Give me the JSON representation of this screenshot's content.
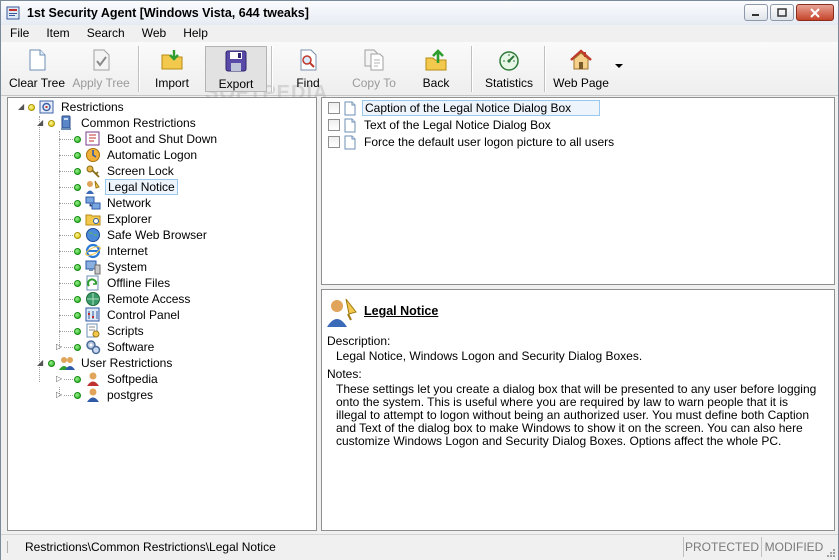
{
  "window": {
    "title": "1st Security Agent [Windows Vista, 644 tweaks]"
  },
  "menu": [
    "File",
    "Item",
    "Search",
    "Web",
    "Help"
  ],
  "toolbar": {
    "clear_tree": "Clear Tree",
    "apply_tree": "Apply Tree",
    "import": "Import",
    "export": "Export",
    "find": "Find",
    "copy_to": "Copy To",
    "back": "Back",
    "statistics": "Statistics",
    "web_page": "Web Page"
  },
  "watermark": "SOFTPEDIA",
  "tree": {
    "root": "Restrictions",
    "common": "Common Restrictions",
    "common_items": [
      "Boot and Shut Down",
      "Automatic Logon",
      "Screen Lock",
      "Legal Notice",
      "Network",
      "Explorer",
      "Safe Web Browser",
      "Internet",
      "System",
      "Offline Files",
      "Remote Access",
      "Control Panel",
      "Scripts",
      "Software"
    ],
    "user": "User Restrictions",
    "user_items": [
      "Softpedia",
      "postgres"
    ]
  },
  "list": {
    "items": [
      "Caption of the Legal Notice Dialog Box",
      "Text of the Legal Notice Dialog Box",
      "Force the default user logon picture to all users"
    ]
  },
  "info": {
    "title": "Legal Notice",
    "description_label": "Description:",
    "description": "Legal Notice, Windows Logon and Security Dialog Boxes.",
    "notes_label": "Notes:",
    "notes": "These settings let you create a dialog box that will be presented to any user before logging onto the system. This is useful where you are required by law to warn people that it is illegal to attempt to logon without being an authorized user. You must define both Caption and Text of the dialog box to make Windows to show it on the screen. You can also here customize Windows Logon and Security Dialog Boxes. Options affect the whole PC."
  },
  "status": {
    "path": "Restrictions\\Common Restrictions\\Legal Notice",
    "protected": "PROTECTED",
    "modified": "MODIFIED"
  }
}
